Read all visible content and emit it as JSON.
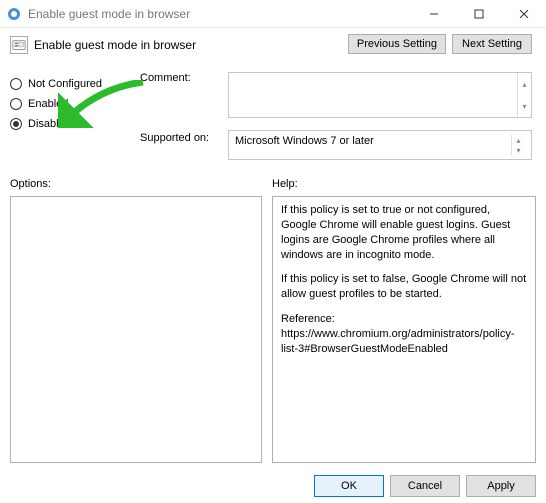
{
  "titlebar": {
    "title": "Enable guest mode in browser"
  },
  "policy": {
    "title": "Enable guest mode in browser"
  },
  "nav": {
    "prev": "Previous Setting",
    "next": "Next Setting"
  },
  "state": {
    "options": [
      {
        "label": "Not Configured",
        "checked": false
      },
      {
        "label": "Enabled",
        "checked": false
      },
      {
        "label": "Disabled",
        "checked": true
      }
    ]
  },
  "labels": {
    "comment": "Comment:",
    "supported": "Supported on:",
    "options": "Options:",
    "help": "Help:"
  },
  "supported": {
    "text": "Microsoft Windows 7 or later"
  },
  "help": {
    "p1": "If this policy is set to true or not configured, Google Chrome will enable guest logins. Guest logins are Google Chrome profiles where all windows are in incognito mode.",
    "p2": "If this policy is set to false, Google Chrome will not allow guest profiles to be started.",
    "p3": "Reference: https://www.chromium.org/administrators/policy-list-3#BrowserGuestModeEnabled"
  },
  "footer": {
    "ok": "OK",
    "cancel": "Cancel",
    "apply": "Apply"
  }
}
